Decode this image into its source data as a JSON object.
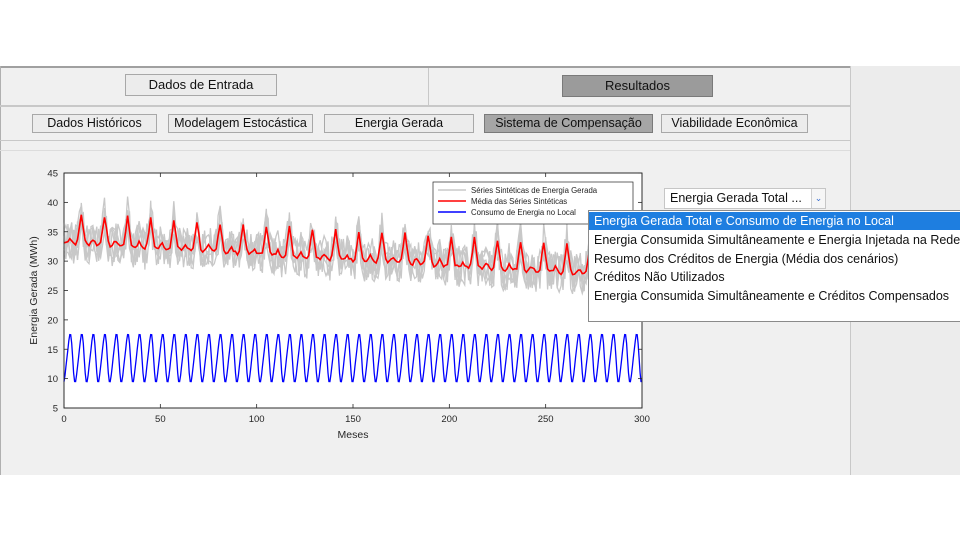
{
  "tabs": [
    {
      "label": "Dados de Entrada",
      "active": false
    },
    {
      "label": "Resultados",
      "active": true
    }
  ],
  "subtabs": [
    {
      "label": "Dados Históricos",
      "active": false
    },
    {
      "label": "Modelagem Estocástica",
      "active": false
    },
    {
      "label": "Energia Gerada",
      "active": false
    },
    {
      "label": "Sistema de Compensação",
      "active": true
    },
    {
      "label": "Viabilidade Econômica",
      "active": false
    }
  ],
  "plot_selector": {
    "selected_label": "Energia Gerada Total ...",
    "arrow_icon": "chevron-down-icon",
    "options": [
      "Energia Gerada Total e Consumo de Energia no Local",
      "Energia Consumida Simultâneamente e Energia Injetada na Rede",
      "Resumo dos Créditos de Energia (Média dos cenários)",
      "Créditos Não Utilizados",
      "Energia Consumida Simultâneamente e Créditos Compensados"
    ],
    "highlighted_index": 0
  },
  "chart_data": {
    "type": "line",
    "xlabel": "Meses",
    "ylabel": "Energia Gerada (MWh)",
    "xlim": [
      0,
      300
    ],
    "ylim": [
      5,
      45
    ],
    "xticks": [
      0,
      50,
      100,
      150,
      200,
      250,
      300
    ],
    "yticks": [
      5,
      10,
      15,
      20,
      25,
      30,
      35,
      40,
      45
    ],
    "grid": false,
    "legend_position": "top-right",
    "series": [
      {
        "name": "Séries Sintéticas de Energia Gerada",
        "color": "#c8c8c8",
        "pattern": "seasonal band around the mean, approx ±3.5 MWh",
        "start_mean": 34.5,
        "end_mean": 28.5,
        "spread": 3.5
      },
      {
        "name": "Média das Séries Sintéticas",
        "color": "#ff0000",
        "pattern": "declining seasonal line, period 12 months",
        "start": 34.5,
        "end": 28.5,
        "seasonal_amplitude": 2.5
      },
      {
        "name": "Consumo de Energia no Local",
        "color": "#0000ff",
        "pattern": "periodic oscillation, period 6 months",
        "min": 9.5,
        "max": 17.5
      }
    ]
  }
}
